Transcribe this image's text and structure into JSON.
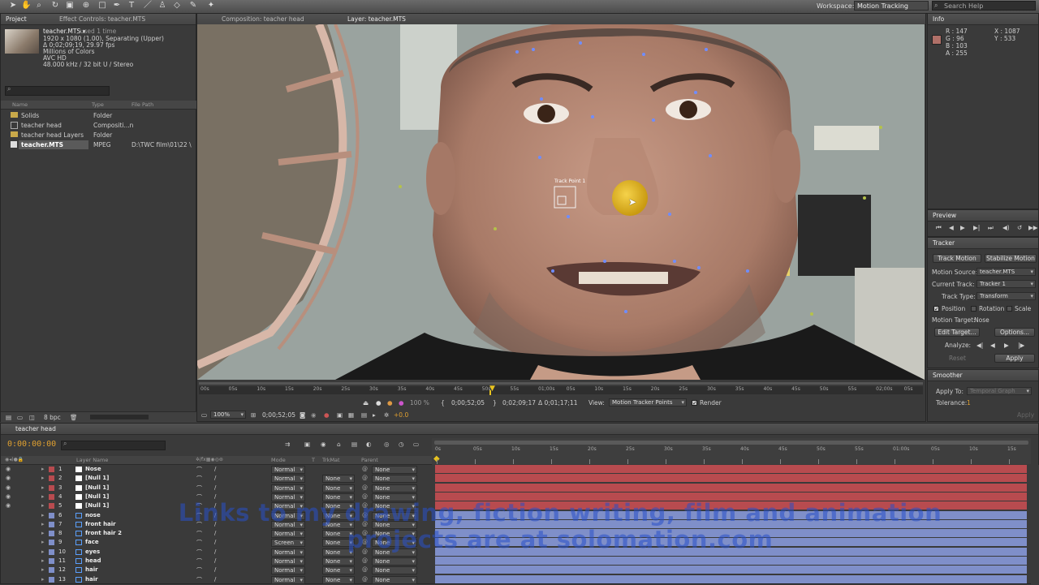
{
  "workspace": {
    "label": "Workspace:",
    "value": "Motion Tracking"
  },
  "search_help": {
    "placeholder": "Search Help"
  },
  "project": {
    "tabs": {
      "project": "Project",
      "effect_controls": "Effect Controls: teacher.MTS"
    },
    "file_name": "teacher.MTS ▾",
    "used": ", used 1 time",
    "info_lines": [
      "1920 x 1080 (1.00), Separating (Upper)",
      "Δ 0;02;09;19, 29.97 fps",
      "Millions of Colors",
      "AVC HD",
      "48.000 kHz / 32 bit U / Stereo"
    ],
    "columns": {
      "name": "Name",
      "type": "Type",
      "path": "File Path"
    },
    "items": [
      {
        "name": "Solids",
        "type": "Folder",
        "path": ""
      },
      {
        "name": "teacher head",
        "type": "Compositi...n",
        "path": ""
      },
      {
        "name": "teacher head Layers",
        "type": "Folder",
        "path": ""
      },
      {
        "name": "teacher.MTS",
        "type": "MPEG",
        "path": "D:\\TWC film\\01\\22 \\"
      }
    ],
    "bpc": "8 bpc"
  },
  "viewer": {
    "tabs": {
      "composition": "Composition: teacher head",
      "layer": "Layer: teacher.MTS"
    },
    "track_point_label": "Track Point 1",
    "ruler": [
      "00s",
      "05s",
      "10s",
      "15s",
      "20s",
      "25s",
      "30s",
      "35s",
      "40s",
      "45s",
      "50s",
      "55s",
      "01;00s",
      "05s",
      "10s",
      "15s",
      "20s",
      "25s",
      "30s",
      "35s",
      "40s",
      "45s",
      "50s",
      "55s",
      "02;00s",
      "05s"
    ],
    "controls": {
      "in_time": "0;00;52;05",
      "out_time": "0;02;09;17",
      "duration": "Δ 0;01;17;11",
      "view_label": "View:",
      "view_value": "Motion Tracker Points",
      "render_label": "Render",
      "zoom": "100%",
      "current_time": "0;00;52;05",
      "exposure": "+0.0",
      "zoom_pct": "100 %"
    }
  },
  "info": {
    "tab": "Info",
    "r": "R : 147",
    "g": "G : 96",
    "b": "B : 103",
    "a": "A : 255",
    "x": "X : 1087",
    "y": "Y : 533",
    "swatch": "#b07068"
  },
  "preview": {
    "tab": "Preview"
  },
  "tracker": {
    "tab": "Tracker",
    "track_motion": "Track Motion",
    "stabilize_motion": "Stabilize Motion",
    "motion_source_label": "Motion Source:",
    "motion_source": "teacher.MTS",
    "current_track_label": "Current Track:",
    "current_track": "Tracker 1",
    "track_type_label": "Track Type:",
    "track_type": "Transform",
    "position": "Position",
    "rotation": "Rotation",
    "scale": "Scale",
    "motion_target_label": "Motion Target:",
    "motion_target": "Nose",
    "edit_target": "Edit Target...",
    "options": "Options...",
    "analyze_label": "Analyze:",
    "reset": "Reset",
    "apply": "Apply"
  },
  "smoother": {
    "tab": "Smoother",
    "apply_to_label": "Apply To:",
    "apply_to": "Temporal Graph",
    "tolerance_label": "Tolerance:",
    "tolerance": "1",
    "apply": "Apply"
  },
  "timeline": {
    "tab": "teacher head",
    "timecode": "0:00:00:00",
    "columns": {
      "layer_name": "Layer Name",
      "mode": "Mode",
      "t": "T",
      "trkmat": "TrkMat",
      "parent": "Parent"
    },
    "ruler": [
      "0s",
      "05s",
      "10s",
      "15s",
      "20s",
      "25s",
      "30s",
      "35s",
      "40s",
      "45s",
      "50s",
      "55s",
      "01:00s",
      "05s",
      "10s",
      "15s"
    ],
    "layers": [
      {
        "num": "1",
        "name": "Nose",
        "mode": "Normal",
        "trkmat": "",
        "parent": "None",
        "color": "#b84b4f",
        "icon": "solid"
      },
      {
        "num": "2",
        "name": "[Null 1]",
        "mode": "Normal",
        "trkmat": "None",
        "parent": "None",
        "color": "#b84b4f",
        "icon": "solid"
      },
      {
        "num": "3",
        "name": "[Null 1]",
        "mode": "Normal",
        "trkmat": "None",
        "parent": "None",
        "color": "#b84b4f",
        "icon": "solid"
      },
      {
        "num": "4",
        "name": "[Null 1]",
        "mode": "Normal",
        "trkmat": "None",
        "parent": "None",
        "color": "#b84b4f",
        "icon": "solid"
      },
      {
        "num": "5",
        "name": "[Null 1]",
        "mode": "Normal",
        "trkmat": "None",
        "parent": "None",
        "color": "#b84b4f",
        "icon": "solid"
      },
      {
        "num": "6",
        "name": "nose",
        "mode": "Normal",
        "trkmat": "None",
        "parent": "None",
        "color": "#7f8fc9",
        "icon": "comp"
      },
      {
        "num": "7",
        "name": "front hair",
        "mode": "Normal",
        "trkmat": "None",
        "parent": "None",
        "color": "#7f8fc9",
        "icon": "comp"
      },
      {
        "num": "8",
        "name": "front hair 2",
        "mode": "Normal",
        "trkmat": "None",
        "parent": "None",
        "color": "#7f8fc9",
        "icon": "comp"
      },
      {
        "num": "9",
        "name": "face",
        "mode": "Screen",
        "trkmat": "None",
        "parent": "None",
        "color": "#7f8fc9",
        "icon": "comp"
      },
      {
        "num": "10",
        "name": "eyes",
        "mode": "Normal",
        "trkmat": "None",
        "parent": "None",
        "color": "#7f8fc9",
        "icon": "comp"
      },
      {
        "num": "11",
        "name": "head",
        "mode": "Normal",
        "trkmat": "None",
        "parent": "None",
        "color": "#7f8fc9",
        "icon": "comp"
      },
      {
        "num": "12",
        "name": "hair",
        "mode": "Normal",
        "trkmat": "None",
        "parent": "None",
        "color": "#7f8fc9",
        "icon": "comp"
      },
      {
        "num": "13",
        "name": "hair",
        "mode": "Normal",
        "trkmat": "None",
        "parent": "None",
        "color": "#7f8fc9",
        "icon": "comp"
      }
    ]
  },
  "watermark": {
    "line1": "Links to my drawing, fiction writing, film and animation",
    "line2": "projects are at solomation.com"
  }
}
